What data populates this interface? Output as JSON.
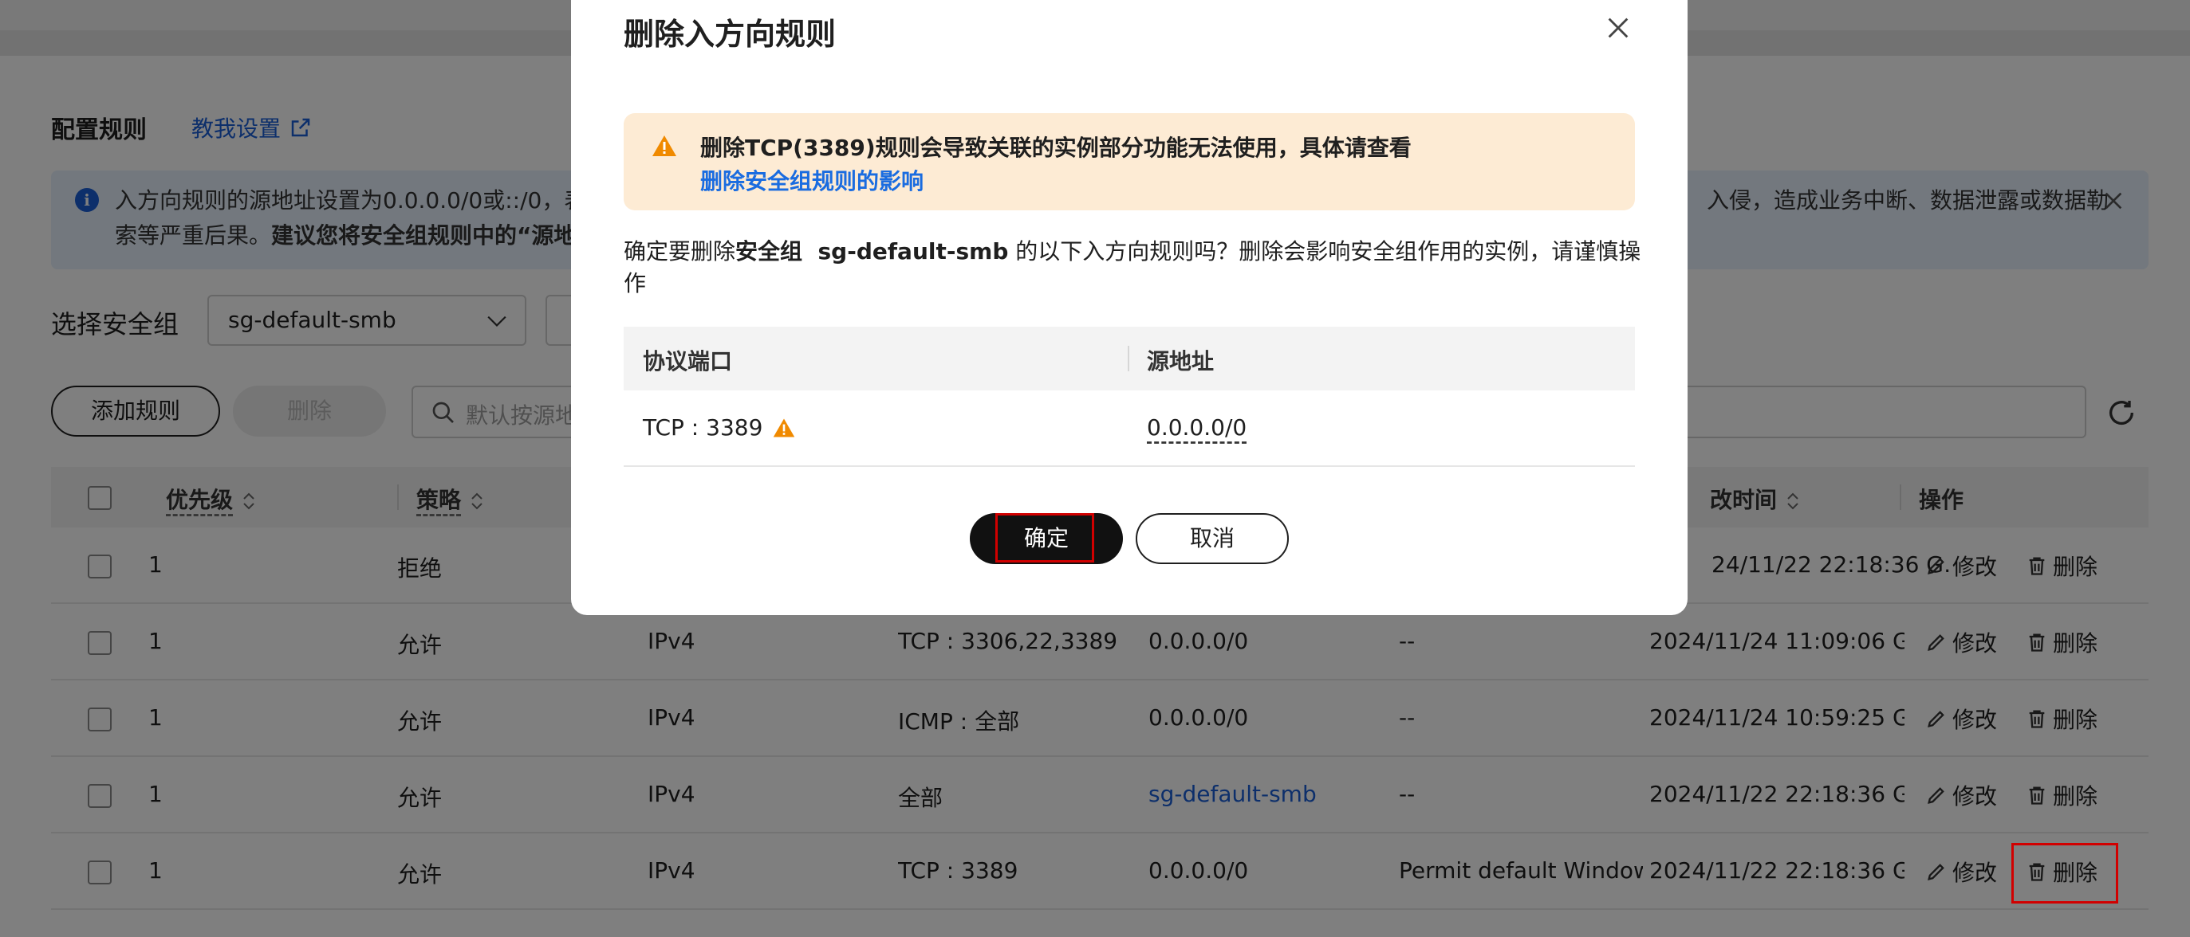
{
  "config": {
    "title": "配置规则",
    "guide_link": "教我设置"
  },
  "alert": {
    "line1_prefix": "入方向规则的源地址设置为0.0.0.0/0或::/0，表",
    "line1_suffix": "入侵，造成业务中断、数据泄露或数据勒",
    "line2_prefix": "索等严重后果。",
    "line2_bold": "建议您将安全组规则中的“源地"
  },
  "security_group": {
    "label": "选择安全组",
    "selected": "sg-default-smb"
  },
  "toolbar": {
    "add_rule": "添加规则",
    "delete": "删除",
    "search_placeholder": "默认按源地"
  },
  "table": {
    "headers": {
      "priority": "优先级",
      "policy": "策略",
      "modified_time": "改时间",
      "actions": "操作"
    },
    "edit_label": "修改",
    "delete_label": "删除",
    "rows": [
      {
        "priority": "1",
        "policy": "拒绝",
        "ip": "",
        "port": "",
        "source": "",
        "desc": "",
        "time": "24/11/22 22:18:36 G…"
      },
      {
        "priority": "1",
        "policy": "允许",
        "ip": "IPv4",
        "port": "TCP : 3306,22,3389",
        "source": "0.0.0.0/0",
        "desc": "--",
        "time": "2024/11/24 11:09:06 G…"
      },
      {
        "priority": "1",
        "policy": "允许",
        "ip": "IPv4",
        "port": "ICMP : 全部",
        "source": "0.0.0.0/0",
        "desc": "--",
        "time": "2024/11/24 10:59:25 G…"
      },
      {
        "priority": "1",
        "policy": "允许",
        "ip": "IPv4",
        "port": "全部",
        "source": "sg-default-smb",
        "desc": "--",
        "time": "2024/11/22 22:18:36 G…"
      },
      {
        "priority": "1",
        "policy": "允许",
        "ip": "IPv4",
        "port": "TCP : 3389",
        "source": "0.0.0.0/0",
        "desc": "Permit default Window…",
        "time": "2024/11/22 22:18:36 G…"
      }
    ]
  },
  "modal": {
    "title": "删除入方向规则",
    "warning_text": "删除TCP(3389)规则会导致关联的实例部分功能无法使用，具体请查看",
    "warning_link": "删除安全组规则的影响",
    "confirm_prefix": "确定要删除",
    "confirm_bold": "安全组  sg-default-smb",
    "confirm_suffix": "的以下入方向规则吗？删除会影响安全组作用的实例，请谨慎操作",
    "col_port": "协议端口",
    "col_source": "源地址",
    "row_port": "TCP : 3389",
    "row_source": "0.0.0.0/0",
    "ok": "确定",
    "cancel": "取消"
  },
  "colors": {
    "accent_blue": "#1a5fd6",
    "warning_orange": "#f08a00",
    "highlight_red": "#d10000"
  }
}
